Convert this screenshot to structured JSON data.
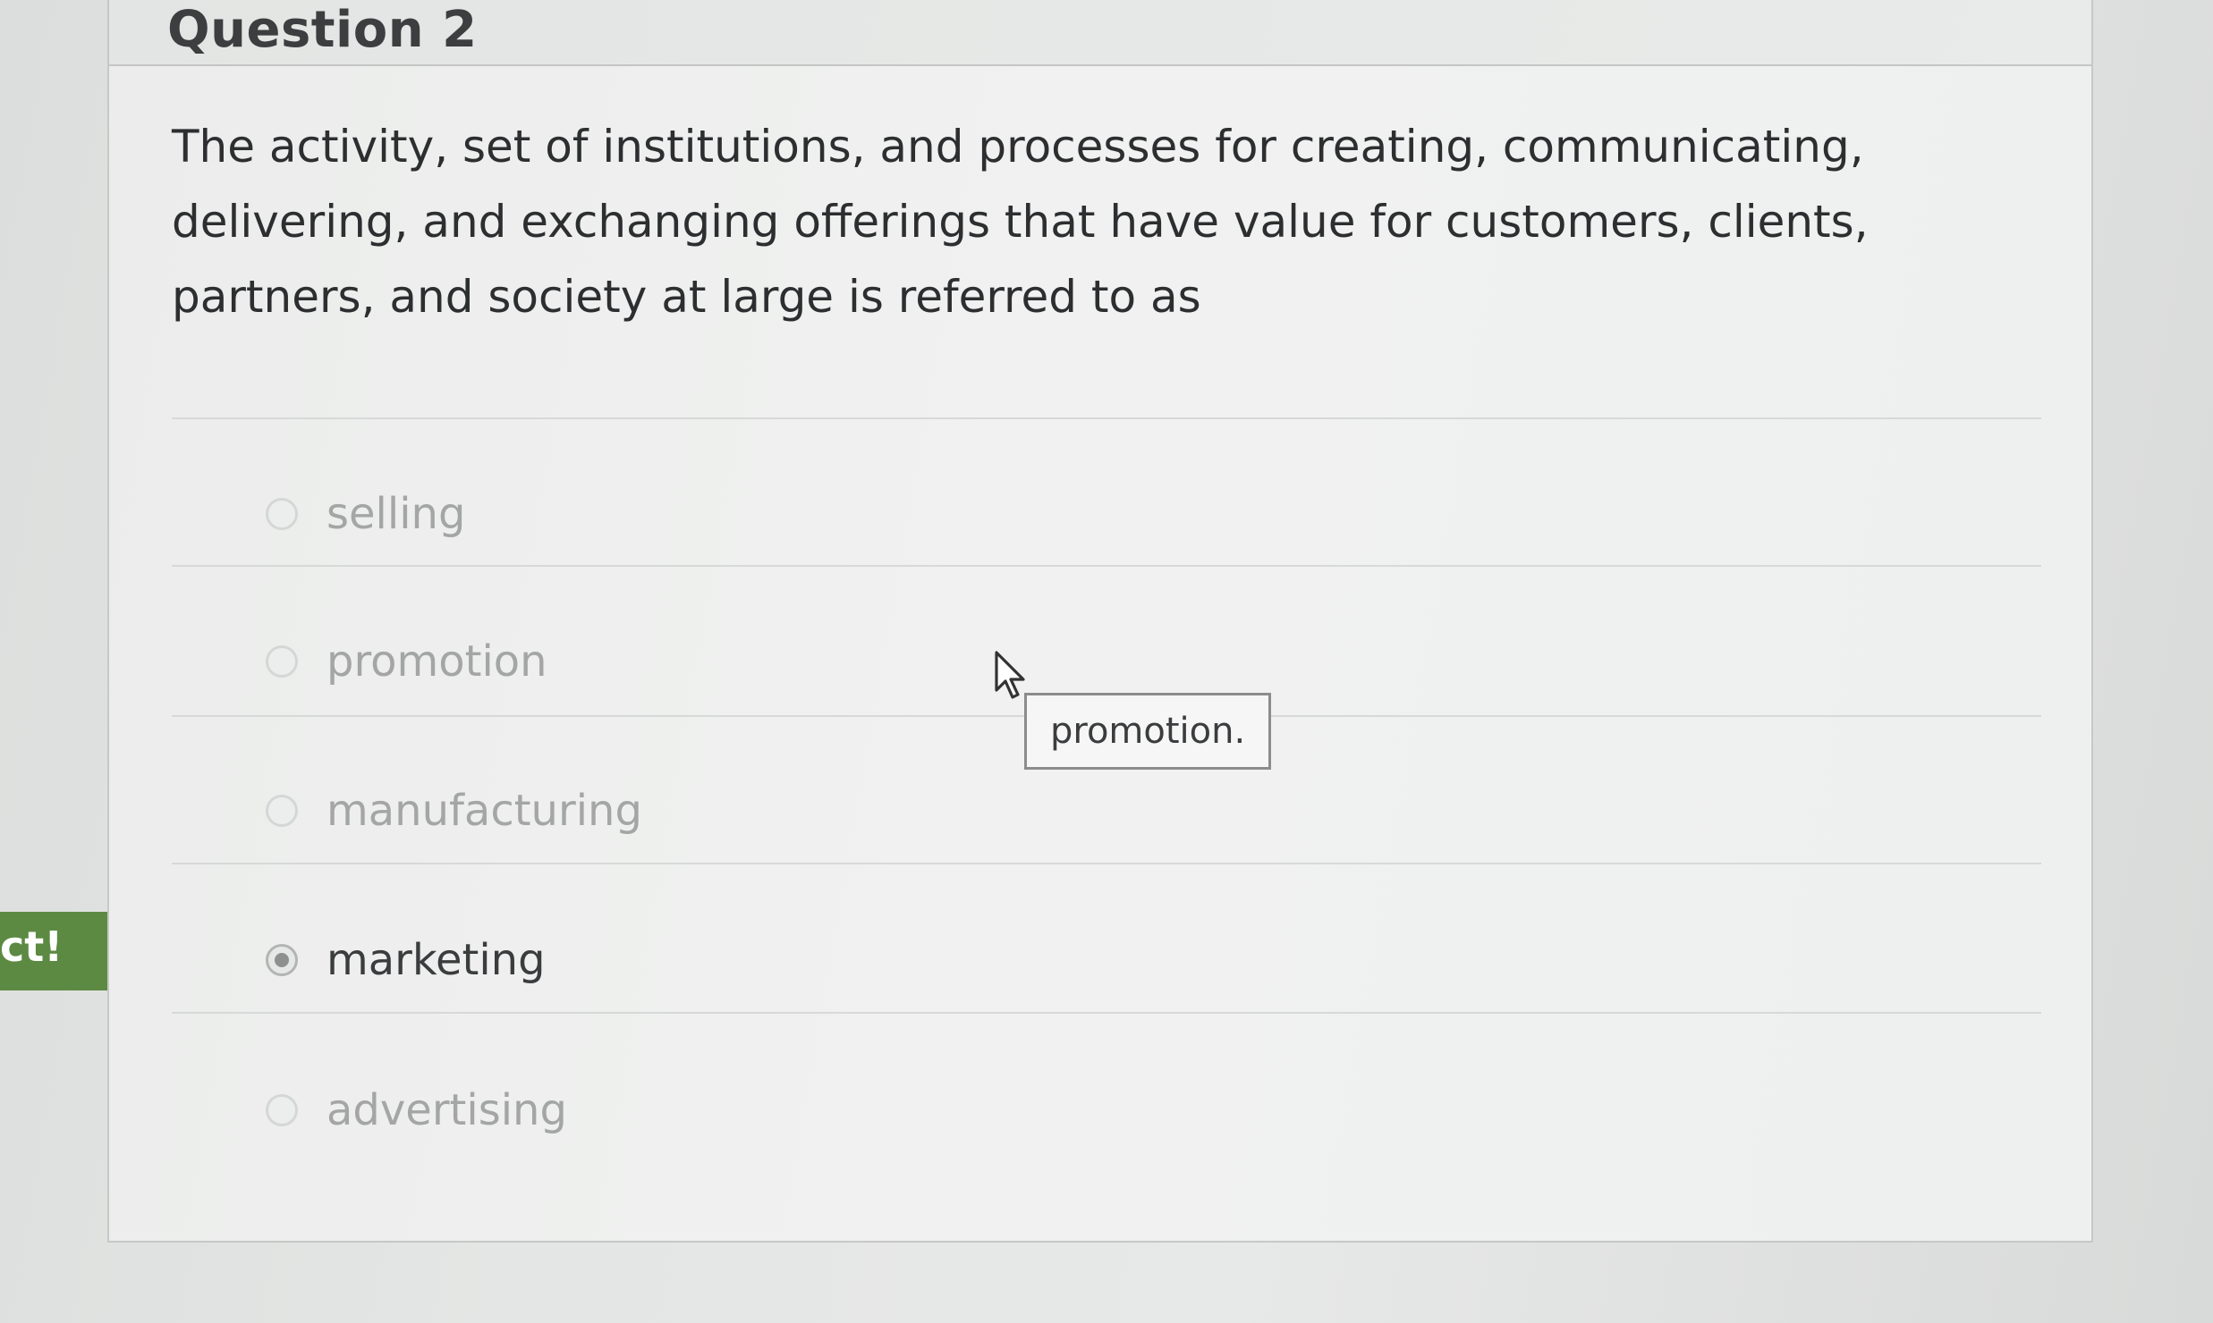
{
  "question": {
    "title": "Question 2",
    "text": "The activity, set of institutions, and processes for creating, communicating, delivering, and exchanging offerings that have value for customers, clients, partners, and society at large is referred to as"
  },
  "options": [
    {
      "label": "selling",
      "selected": false
    },
    {
      "label": "promotion",
      "selected": false
    },
    {
      "label": "manufacturing",
      "selected": false
    },
    {
      "label": "marketing",
      "selected": true
    },
    {
      "label": "advertising",
      "selected": false
    }
  ],
  "tooltip": {
    "text": "promotion."
  },
  "feedback_badge": {
    "text": "ct!",
    "color": "#5c8a42"
  },
  "icons": [
    "radio-button-icon",
    "mouse-cursor-icon"
  ]
}
